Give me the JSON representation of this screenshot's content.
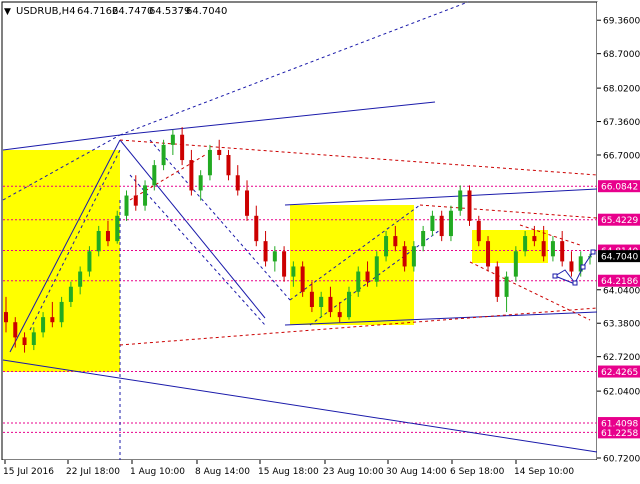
{
  "header": {
    "arrow_glyph": "▼",
    "symbol": "USDRUB,H4",
    "open": "64.7162",
    "high": "64.7470",
    "low": "64.5379",
    "close": "64.7040"
  },
  "y_axis": {
    "ticks": [
      "69.3600",
      "68.7000",
      "68.0200",
      "67.3600",
      "66.7000",
      "64.0400",
      "63.3800",
      "62.7200",
      "62.0400",
      "60.7200"
    ],
    "min": 60.72,
    "max": 69.68
  },
  "x_axis": {
    "labels": [
      "15 Jul 2016",
      "22 Jul 18:00",
      "1 Aug 10:00",
      "8 Aug 14:00",
      "15 Aug 18:00",
      "23 Aug 10:00",
      "30 Aug 14:00",
      "6 Sep 18:00",
      "14 Sep 10:00"
    ]
  },
  "price_levels": [
    {
      "value": "66.0842",
      "color": "#e8008c"
    },
    {
      "value": "65.4229",
      "color": "#e8008c"
    },
    {
      "value": "64.8140",
      "color": "#e8008c"
    },
    {
      "value": "64.7040",
      "color": "#000000"
    },
    {
      "value": "64.2186",
      "color": "#e8008c"
    },
    {
      "value": "62.4265",
      "color": "#e8008c"
    },
    {
      "value": "61.4098",
      "color": "#e8008c"
    },
    {
      "value": "61.2258",
      "color": "#e8008c"
    }
  ],
  "colors": {
    "bull_candle": "#22aa22",
    "bear_candle": "#cc0000",
    "zone": "#ffff00",
    "trendline": "#1a1aaa",
    "projection": "#cc0000",
    "level_line": "#e8008c"
  },
  "chart_data": {
    "type": "candlestick",
    "title": "USDRUB,H4",
    "ylim": [
      60.72,
      69.68
    ],
    "candles_ohlc": [
      [
        63.6,
        63.9,
        63.2,
        63.4
      ],
      [
        63.4,
        63.5,
        62.9,
        63.1
      ],
      [
        63.1,
        63.2,
        62.8,
        62.95
      ],
      [
        62.95,
        63.3,
        62.85,
        63.2
      ],
      [
        63.2,
        63.6,
        63.1,
        63.5
      ],
      [
        63.5,
        63.8,
        63.3,
        63.4
      ],
      [
        63.4,
        63.9,
        63.3,
        63.8
      ],
      [
        63.8,
        64.2,
        63.7,
        64.1
      ],
      [
        64.1,
        64.5,
        63.95,
        64.4
      ],
      [
        64.4,
        64.9,
        64.3,
        64.8
      ],
      [
        64.8,
        65.3,
        64.7,
        65.2
      ],
      [
        65.2,
        65.4,
        64.9,
        65.0
      ],
      [
        65.0,
        65.6,
        64.95,
        65.5
      ],
      [
        65.5,
        66.0,
        65.4,
        65.9
      ],
      [
        65.9,
        66.3,
        65.6,
        65.7
      ],
      [
        65.7,
        66.2,
        65.6,
        66.1
      ],
      [
        66.1,
        66.6,
        66.0,
        66.5
      ],
      [
        66.5,
        67.0,
        66.4,
        66.9
      ],
      [
        66.9,
        67.2,
        66.7,
        67.1
      ],
      [
        67.1,
        67.25,
        66.5,
        66.6
      ],
      [
        66.6,
        66.8,
        65.9,
        66.0
      ],
      [
        66.0,
        66.4,
        65.8,
        66.3
      ],
      [
        66.3,
        66.9,
        66.2,
        66.8
      ],
      [
        66.8,
        67.0,
        66.6,
        66.7
      ],
      [
        66.7,
        66.8,
        66.2,
        66.3
      ],
      [
        66.3,
        66.5,
        65.9,
        66.0
      ],
      [
        66.0,
        66.2,
        65.4,
        65.5
      ],
      [
        65.5,
        65.7,
        64.9,
        65.0
      ],
      [
        65.0,
        65.2,
        64.5,
        64.6
      ],
      [
        64.6,
        64.9,
        64.4,
        64.8
      ],
      [
        64.8,
        64.9,
        64.2,
        64.3
      ],
      [
        64.3,
        64.6,
        64.1,
        64.5
      ],
      [
        64.5,
        64.6,
        63.9,
        64.0
      ],
      [
        64.0,
        64.2,
        63.6,
        63.7
      ],
      [
        63.7,
        64.0,
        63.5,
        63.9
      ],
      [
        63.9,
        64.1,
        63.5,
        63.6
      ],
      [
        63.6,
        63.8,
        63.4,
        63.5
      ],
      [
        63.5,
        64.1,
        63.45,
        64.0
      ],
      [
        64.0,
        64.5,
        63.9,
        64.4
      ],
      [
        64.4,
        64.6,
        64.1,
        64.2
      ],
      [
        64.2,
        64.8,
        64.1,
        64.7
      ],
      [
        64.7,
        65.2,
        64.6,
        65.1
      ],
      [
        65.1,
        65.3,
        64.8,
        64.9
      ],
      [
        64.9,
        65.0,
        64.4,
        64.5
      ],
      [
        64.5,
        65.0,
        64.4,
        64.9
      ],
      [
        64.9,
        65.3,
        64.8,
        65.2
      ],
      [
        65.2,
        65.6,
        65.1,
        65.5
      ],
      [
        65.5,
        65.6,
        65.0,
        65.1
      ],
      [
        65.1,
        65.7,
        65.0,
        65.6
      ],
      [
        65.6,
        66.1,
        65.5,
        66.0
      ],
      [
        66.0,
        66.1,
        65.3,
        65.4
      ],
      [
        65.4,
        65.5,
        64.9,
        65.0
      ],
      [
        65.0,
        65.1,
        64.4,
        64.5
      ],
      [
        64.5,
        64.6,
        63.8,
        63.9
      ],
      [
        63.9,
        64.4,
        63.6,
        64.3
      ],
      [
        64.3,
        64.9,
        64.2,
        64.8
      ],
      [
        64.8,
        65.2,
        64.7,
        65.1
      ],
      [
        65.1,
        65.3,
        64.9,
        65.0
      ],
      [
        65.0,
        65.3,
        64.6,
        64.7
      ],
      [
        64.7,
        65.1,
        64.6,
        65.0
      ],
      [
        65.0,
        65.2,
        64.5,
        64.6
      ],
      [
        64.6,
        64.8,
        64.3,
        64.4
      ],
      [
        64.4,
        64.8,
        64.3,
        64.7
      ],
      [
        64.7,
        64.75,
        64.54,
        64.7
      ]
    ],
    "horizontal_levels": [
      66.0842,
      65.4229,
      64.814,
      64.2186,
      62.4265,
      61.4098,
      61.2258
    ],
    "current_price": 64.704
  }
}
